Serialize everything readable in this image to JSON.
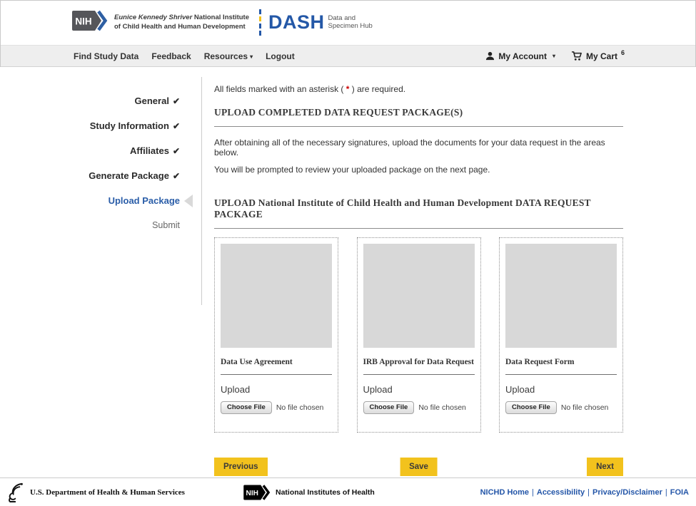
{
  "colors": {
    "accent_blue": "#2458A7",
    "accent_yellow": "#F2C21D",
    "asterisk_red": "#CC0000",
    "nav_bg": "#EEEEEE",
    "placeholder_gray": "#D8D8D8",
    "nih_logo_gray": "#55565A"
  },
  "icons": {
    "check": "✔",
    "caret_down": "▾"
  },
  "header": {
    "nih_logo_text": "NIH",
    "institute_italic": "Eunice Kennedy Shriver",
    "institute_line1_rest": " National Institute",
    "institute_line2": "of Child Health and Human Development",
    "dash_acronym": "DASH",
    "dash_sub_line1": "Data and",
    "dash_sub_line2": "Specimen Hub"
  },
  "nav": {
    "items": [
      {
        "label": "Find Study Data"
      },
      {
        "label": "Feedback"
      },
      {
        "label": "Resources"
      },
      {
        "label": "Logout"
      }
    ],
    "account_label": "My Account",
    "cart_label": "My Cart",
    "cart_count": "6"
  },
  "sidebar": {
    "steps": [
      {
        "label": "General",
        "completed": true
      },
      {
        "label": "Study Information",
        "completed": true
      },
      {
        "label": "Affiliates",
        "completed": true
      },
      {
        "label": "Generate Package",
        "completed": true
      },
      {
        "label": "Upload Package",
        "completed": false,
        "current": true
      },
      {
        "label": "Submit",
        "completed": false
      }
    ]
  },
  "main": {
    "required_note_prefix": "All fields marked with an asterisk ( ",
    "asterisk": "*",
    "required_note_suffix": " ) are required.",
    "section1_title": "UPLOAD COMPLETED DATA REQUEST PACKAGE(S)",
    "paragraph1": "After obtaining all of the necessary signatures, upload the documents for your data request in the areas below.",
    "paragraph2": "You will be prompted to review your uploaded package on the next page.",
    "section2_title": "UPLOAD National Institute of Child Health and Human Development DATA REQUEST PACKAGE",
    "upload_cards": [
      {
        "title": "Data Use Agreement",
        "upload_label": "Upload",
        "file_button": "Choose File",
        "file_status": "No file chosen"
      },
      {
        "title": "IRB Approval for Data Request",
        "upload_label": "Upload",
        "file_button": "Choose File",
        "file_status": "No file chosen"
      },
      {
        "title": "Data Request Form",
        "upload_label": "Upload",
        "file_button": "Choose File",
        "file_status": "No file chosen"
      }
    ],
    "buttons": {
      "previous": "Previous",
      "save": "Save",
      "next": "Next"
    }
  },
  "footer": {
    "hhs_label": "U.S. Department of Health & Human Services",
    "nih_logo_text": "NIH",
    "nih_label": "National Institutes of Health",
    "links": [
      {
        "label": "NICHD Home"
      },
      {
        "label": "Accessibility"
      },
      {
        "label": "Privacy/Disclaimer"
      },
      {
        "label": "FOIA"
      }
    ]
  }
}
